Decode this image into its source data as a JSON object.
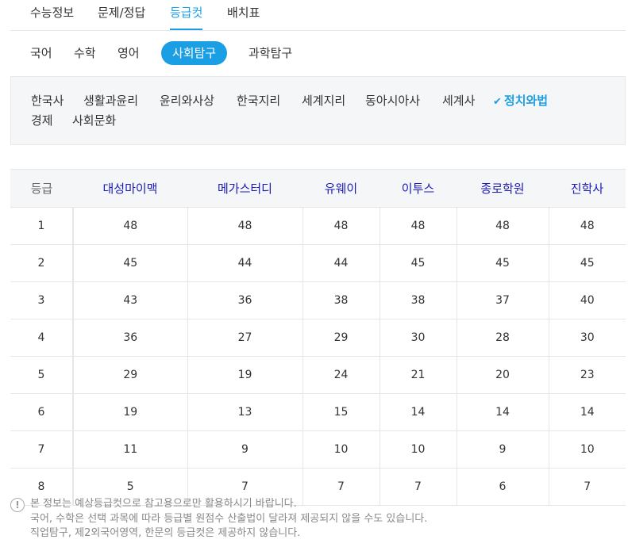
{
  "main_tabs": [
    {
      "label": "수능정보"
    },
    {
      "label": "문제/정답"
    },
    {
      "label": "등급컷"
    },
    {
      "label": "배치표"
    }
  ],
  "active_main_tab": "등급컷",
  "sub_tabs": [
    {
      "label": "국어"
    },
    {
      "label": "수학"
    },
    {
      "label": "영어"
    },
    {
      "label": "사회탐구"
    },
    {
      "label": "과학탐구"
    }
  ],
  "active_sub_tab": "사회탐구",
  "subjects": [
    {
      "label": "한국사"
    },
    {
      "label": "생활과윤리"
    },
    {
      "label": "윤리와사상"
    },
    {
      "label": "한국지리"
    },
    {
      "label": "세계지리"
    },
    {
      "label": "동아시아사"
    },
    {
      "label": "세계사"
    },
    {
      "label": "정치와법"
    },
    {
      "label": "경제"
    },
    {
      "label": "사회문화"
    }
  ],
  "active_subject": "정치와법",
  "table": {
    "headers": [
      "등급",
      "대성마이맥",
      "메가스터디",
      "유웨이",
      "이투스",
      "종로학원",
      "진학사"
    ],
    "rows": [
      [
        "1",
        "48",
        "48",
        "48",
        "48",
        "48",
        "48"
      ],
      [
        "2",
        "45",
        "44",
        "44",
        "45",
        "45",
        "45"
      ],
      [
        "3",
        "43",
        "36",
        "38",
        "38",
        "37",
        "40"
      ],
      [
        "4",
        "36",
        "27",
        "29",
        "30",
        "28",
        "30"
      ],
      [
        "5",
        "29",
        "19",
        "24",
        "21",
        "20",
        "23"
      ],
      [
        "6",
        "19",
        "13",
        "15",
        "14",
        "14",
        "14"
      ],
      [
        "7",
        "11",
        "9",
        "10",
        "10",
        "9",
        "10"
      ],
      [
        "8",
        "5",
        "7",
        "7",
        "7",
        "6",
        "7"
      ]
    ]
  },
  "notice": {
    "icon": "exclamation-icon",
    "lines": [
      "본 정보는 예상등급컷으로 참고용으로만 활용하시기 바랍니다.",
      "국어, 수학은 선택 과목에 따라 등급별 원점수 산출법이 달라져 제공되지 않을 수도 있습니다.",
      "직업탐구, 제2외국어영역, 한문의 등급컷은 제공하지 않습니다."
    ]
  },
  "colors": {
    "accent": "#1a9fe5",
    "header_text": "#1a1ab8",
    "muted": "#888888"
  }
}
